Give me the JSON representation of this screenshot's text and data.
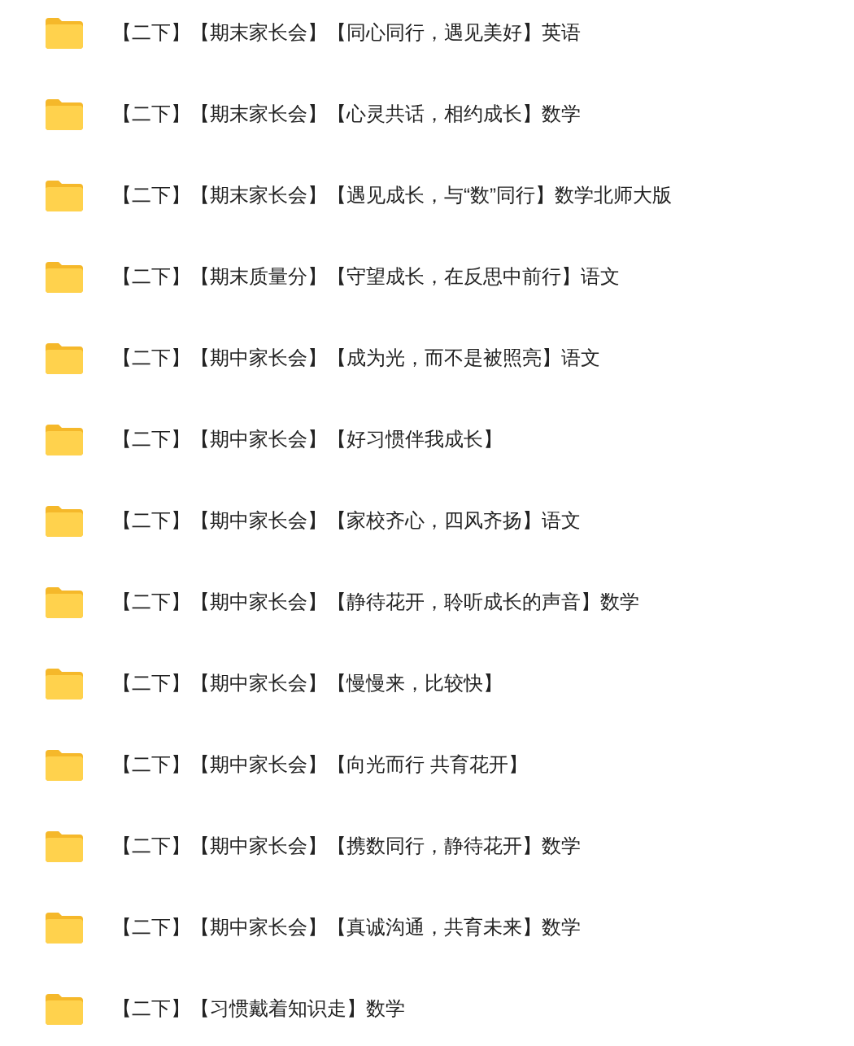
{
  "folders": [
    {
      "name": "【二下】【期末家长会】【同心同行，遇见美好】英语"
    },
    {
      "name": "【二下】【期末家长会】【心灵共话，相约成长】数学"
    },
    {
      "name": "【二下】【期末家长会】【遇见成长，与“数”同行】数学北师大版"
    },
    {
      "name": "【二下】【期末质量分】【守望成长，在反思中前行】语文"
    },
    {
      "name": "【二下】【期中家长会】【成为光，而不是被照亮】语文"
    },
    {
      "name": "【二下】【期中家长会】【好习惯伴我成长】"
    },
    {
      "name": "【二下】【期中家长会】【家校齐心，四风齐扬】语文"
    },
    {
      "name": "【二下】【期中家长会】【静待花开，聆听成长的声音】数学"
    },
    {
      "name": "【二下】【期中家长会】【慢慢来，比较快】"
    },
    {
      "name": "【二下】【期中家长会】【向光而行 共育花开】"
    },
    {
      "name": "【二下】【期中家长会】【携数同行，静待花开】数学"
    },
    {
      "name": "【二下】【期中家长会】【真诚沟通，共育未来】数学"
    },
    {
      "name": "【二下】【习惯戴着知识走】数学"
    }
  ]
}
